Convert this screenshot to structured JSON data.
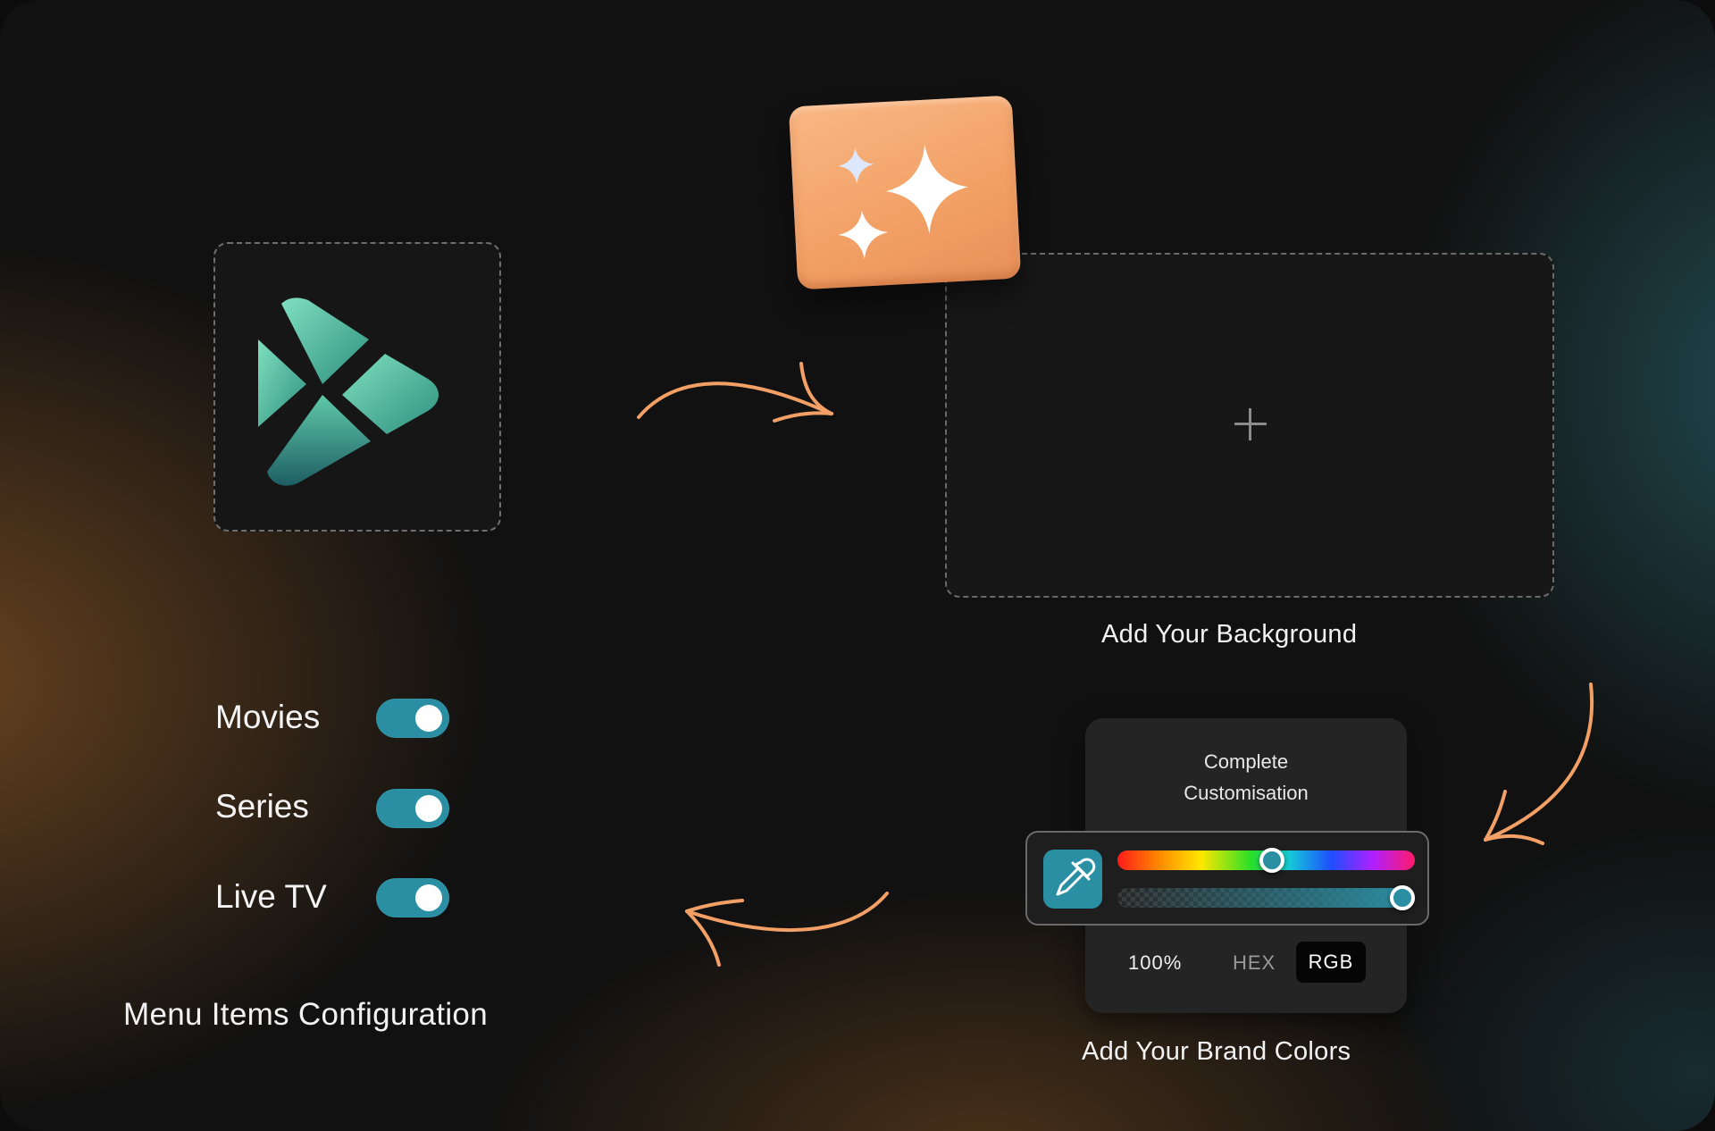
{
  "logo": {
    "icon": "play-x-logo-icon"
  },
  "sparkle_card": {
    "icon": "sparkles-icon",
    "color": "#f2a065"
  },
  "background_section": {
    "caption": "Add Your Background",
    "add_icon": "plus-icon"
  },
  "menu_config": {
    "title": "Menu Items Configuration",
    "items": [
      {
        "label": "Movies",
        "enabled": true
      },
      {
        "label": "Series",
        "enabled": true
      },
      {
        "label": "Live TV",
        "enabled": true
      }
    ],
    "toggle_color": "#2a8fa3"
  },
  "color_picker": {
    "title_line1": "Complete",
    "title_line2": "Customisation",
    "eyedropper_icon": "eyedropper-icon",
    "hue_position": 0.52,
    "opacity_position": 1.0,
    "opacity_value": "100%",
    "formats": [
      "HEX",
      "RGB"
    ],
    "selected_format": "RGB",
    "caption": "Add Your Brand Colors",
    "selected_color": "#2a8fa3"
  },
  "arrows": [
    "curved-arrow-right",
    "curved-arrow-down-left",
    "curved-arrow-left"
  ],
  "accent_color": "#f2a065"
}
